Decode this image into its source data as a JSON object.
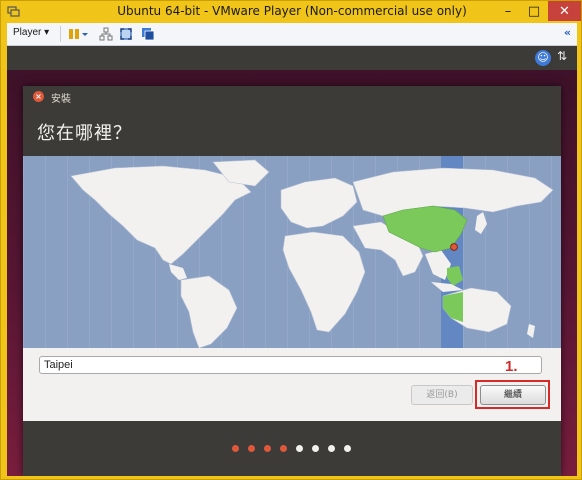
{
  "window": {
    "title": "Ubuntu 64-bit - VMware Player (Non-commercial use only)",
    "minimize_glyph": "–",
    "maximize_glyph": "□",
    "close_glyph": "✕"
  },
  "toolbar": {
    "player_menu": "Player ▾",
    "collapse_glyph": "«"
  },
  "panel": {
    "network_glyph": "⇅"
  },
  "installer": {
    "window_title": "安裝",
    "heading": "您在哪裡？",
    "location_value": "Taipei",
    "back_button": "返回(B)",
    "continue_button": "繼續",
    "annotation": "1.",
    "progress": {
      "total": 8,
      "completed": 4
    }
  },
  "colors": {
    "accent": "#e0583a",
    "annotation": "#d42a2a",
    "highlight_region": "#7ac95a",
    "ocean": "#8aa0c3",
    "timezone_band": "#5b83c2"
  },
  "icons": [
    "vmware-app-icon",
    "pause-icon",
    "dropdown-icon",
    "network-share-icon",
    "fullscreen-icon",
    "unity-icon",
    "collapse-icon",
    "accessibility-icon",
    "network-icon",
    "close-icon",
    "location-marker-icon"
  ]
}
